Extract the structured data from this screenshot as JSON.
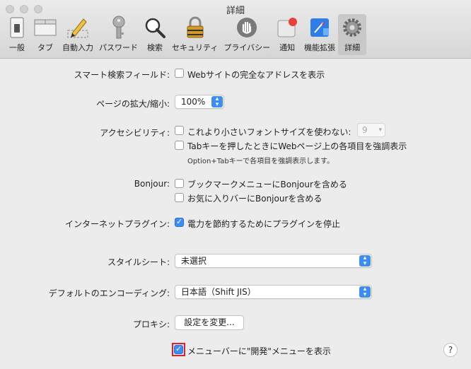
{
  "window": {
    "title": "詳細"
  },
  "toolbar": {
    "tabs": [
      {
        "label": "一般",
        "icon": "switch-icon"
      },
      {
        "label": "タブ",
        "icon": "tabs-icon"
      },
      {
        "label": "自動入力",
        "icon": "pencil-icon"
      },
      {
        "label": "パスワード",
        "icon": "key-icon"
      },
      {
        "label": "検索",
        "icon": "magnifier-icon"
      },
      {
        "label": "セキュリティ",
        "icon": "lock-icon"
      },
      {
        "label": "プライバシー",
        "icon": "hand-icon"
      },
      {
        "label": "通知",
        "icon": "notification-icon"
      },
      {
        "label": "機能拡張",
        "icon": "extension-icon"
      },
      {
        "label": "詳細",
        "icon": "gear-icon",
        "active": true
      }
    ]
  },
  "settings": {
    "smart_search": {
      "label": "スマート検索フィールド:",
      "option": "Webサイトの完全なアドレスを表示",
      "checked": false
    },
    "zoom": {
      "label": "ページの拡大/縮小:",
      "value": "100%"
    },
    "accessibility": {
      "label": "アクセシビリティ:",
      "option1": "これより小さいフォントサイズを使わない:",
      "font_size": "9",
      "option2": "Tabキーを押したときにWebページ上の各項目を強調表示",
      "note": "Option+Tabキーで各項目を強調表示します。"
    },
    "bonjour": {
      "label": "Bonjour:",
      "option1": "ブックマークメニューにBonjourを含める",
      "option2": "お気に入りバーにBonjourを含める"
    },
    "plugins": {
      "label": "インターネットプラグイン:",
      "option": "電力を節約するためにプラグインを停止",
      "checked": true
    },
    "stylesheet": {
      "label": "スタイルシート:",
      "value": "未選択"
    },
    "encoding": {
      "label": "デフォルトのエンコーディング:",
      "value": "日本語（Shift JIS）"
    },
    "proxy": {
      "label": "プロキシ:",
      "button": "設定を変更..."
    },
    "develop_menu": {
      "option": "メニューバーに\"開発\"メニューを表示",
      "checked": true,
      "highlight_color": "#e0202a"
    },
    "help": "?"
  }
}
